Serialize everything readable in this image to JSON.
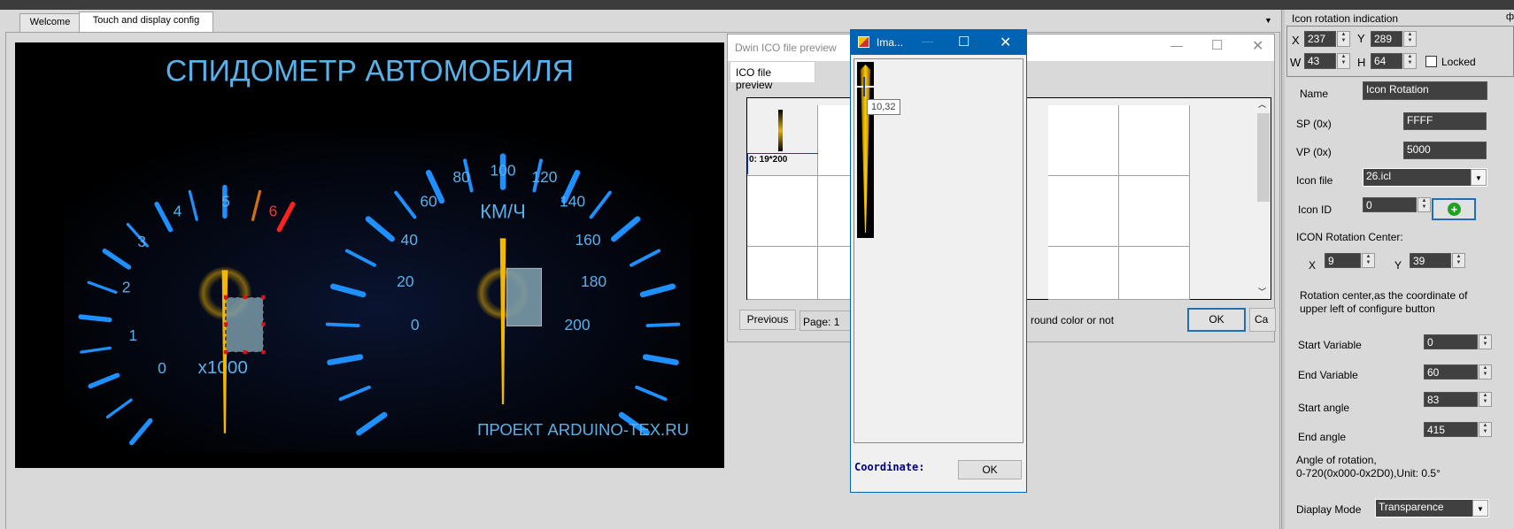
{
  "tabs": [
    {
      "label": "Welcome"
    },
    {
      "label": "Touch and display config"
    }
  ],
  "canvas": {
    "title": "СПИДОМЕТР АВТОМОБИЛЯ",
    "tach_labels": [
      "0",
      "1",
      "2",
      "3",
      "4",
      "5",
      "6"
    ],
    "tach_unit": "x1000",
    "speed_labels": [
      "0",
      "20",
      "40",
      "60",
      "80",
      "100",
      "120",
      "140",
      "160",
      "180",
      "200"
    ],
    "speed_unit": "КМ/Ч",
    "footer": "ПРОЕКТ ARDUINO-TEX.RU",
    "colors": {
      "tick": "#1e90ff",
      "label": "#5ab0e8",
      "redline": "#ff2020",
      "needle": "#f5b800"
    }
  },
  "ico_preview": {
    "title": "Dwin ICO file preview",
    "tab": "ICO file preview",
    "first_icon_label": "0:  19*200",
    "previous_label": "Previous",
    "page_label": "Page: 1",
    "bg_text": "round color or not",
    "ok_label": "OK",
    "cancel_label": "Ca"
  },
  "image_window": {
    "title": "Ima...",
    "tooltip": "10,32",
    "coordinate_label": "Coordinate:",
    "ok_label": "OK",
    "title_color": "#0063b1"
  },
  "panel": {
    "header": "Icon rotation indication",
    "x_label": "X",
    "x": "237",
    "y_label": "Y",
    "y": "289",
    "w_label": "W",
    "w": "43",
    "h_label": "H",
    "h": "64",
    "locked_label": "Locked",
    "locked": false,
    "name_label": "Name",
    "name": "Icon Rotation",
    "sp_label": "SP (0x)",
    "sp": "FFFF",
    "vp_label": "VP (0x)",
    "vp": "5000",
    "icon_file_label": "Icon file",
    "icon_file": "26.icl",
    "icon_id_label": "Icon ID",
    "icon_id": "0",
    "rotation_center_label": "ICON Rotation Center:",
    "rc_x_label": "X",
    "rc_x": "9",
    "rc_y_label": "Y",
    "rc_y": "39",
    "rc_note_1": "Rotation center,as the coordinate of",
    "rc_note_2": "upper left of configure button",
    "start_var_label": "Start  Variable",
    "start_var": "0",
    "end_var_label": "End Variable",
    "end_var": "60",
    "start_angle_label": "Start angle",
    "start_angle": "83",
    "end_angle_label": "End angle",
    "end_angle": "415",
    "angle_note_1": "Angle of rotation,",
    "angle_note_2": "0-720(0x000-0x2D0),Unit: 0.5°",
    "display_mode_label": "Diaplay Mode",
    "display_mode": "Transparence"
  }
}
